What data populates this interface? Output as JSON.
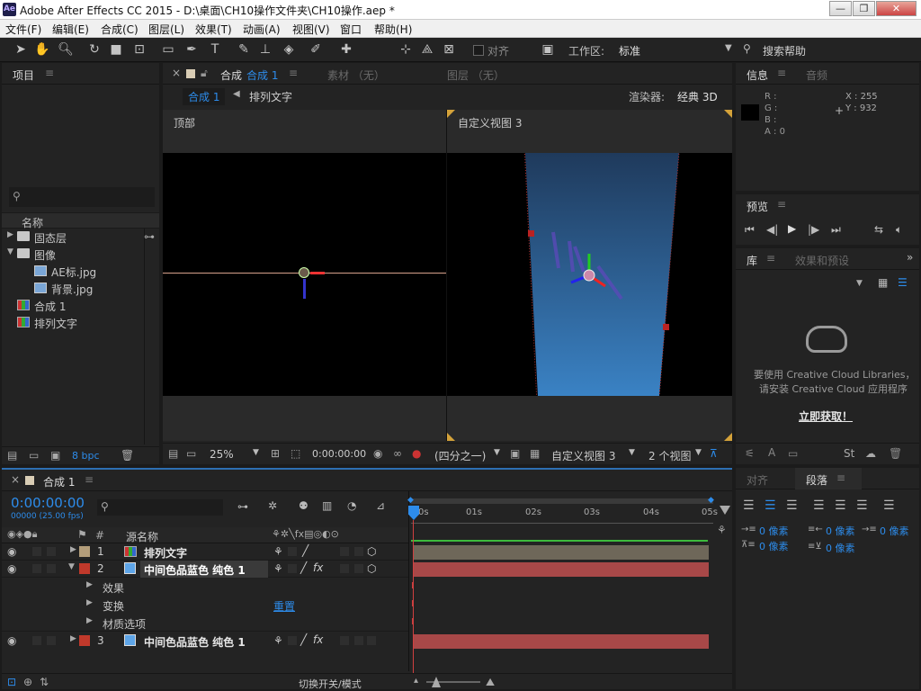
{
  "window": {
    "title": "Adobe After Effects CC 2015 - D:\\桌面\\CH10操作文件夹\\CH10操作.aep *",
    "app_icon": "Ae",
    "min": "—",
    "max": "❐",
    "close": "✕"
  },
  "menu": [
    "文件(F)",
    "编辑(E)",
    "合成(C)",
    "图层(L)",
    "效果(T)",
    "动画(A)",
    "视图(V)",
    "窗口",
    "帮助(H)"
  ],
  "toolbar": {
    "snap_label": "对齐",
    "workspace_label": "工作区:",
    "workspace_value": "标准",
    "search_help": "搜索帮助"
  },
  "project": {
    "title": "项目",
    "col_name": "名称",
    "footer_bpc": "8 bpc",
    "items": [
      {
        "name": "固态层",
        "type": "folder"
      },
      {
        "name": "图像",
        "type": "folder"
      },
      {
        "name": "AE标.jpg",
        "type": "image"
      },
      {
        "name": "背景.jpg",
        "type": "image"
      },
      {
        "name": "合成 1",
        "type": "comp"
      },
      {
        "name": "排列文字",
        "type": "comp"
      }
    ]
  },
  "comp_viewer": {
    "tab_label": "合成",
    "tab_name": "合成 1",
    "footage_tab": "素材 （无）",
    "layer_tab": "图层 （无）",
    "breadcrumb_active": "合成 1",
    "breadcrumb_next": "排列文字",
    "renderer_label": "渲染器:",
    "renderer_value": "经典 3D",
    "view_left": "顶部",
    "view_right": "自定义视图 3",
    "bottom": {
      "zoom": "25%",
      "timecode": "0:00:00:00",
      "resolution": "(四分之一)",
      "view_name": "自定义视图 3",
      "view_count": "2 个视图"
    }
  },
  "info": {
    "tab_info": "信息",
    "tab_audio": "音频",
    "r": "R :",
    "g": "G :",
    "b": "B :",
    "a": "A : 0",
    "x": "X : 255",
    "y": "Y : 932"
  },
  "preview": {
    "title": "预览"
  },
  "library": {
    "tab_lib": "库",
    "tab_effects": "效果和预设",
    "message_line1": "要使用 Creative Cloud Libraries，",
    "message_line2": "请安装 Creative Cloud 应用程序",
    "link": "立即获取！"
  },
  "paragraph": {
    "tab_align": "对齐",
    "tab_para": "段落",
    "indent_left": "0 像素",
    "indent_right": "0 像素",
    "indent_first": "0 像素",
    "space_before": "0 像素",
    "space_after": "0 像素"
  },
  "timeline": {
    "tab_name": "合成 1",
    "timecode": "0:00:00:00",
    "fps": "00000 (25.00 fps)",
    "col_num": "#",
    "col_source": "源名称",
    "time_marks": [
      "0s",
      "01s",
      "02s",
      "03s",
      "04s",
      "05s"
    ],
    "footer_label": "切换开关/模式",
    "layers": [
      {
        "num": "1",
        "name": "排列文字",
        "label_color": "#b39d7a",
        "icon": "comp"
      },
      {
        "num": "2",
        "name": "中间色品蓝色 纯色 1",
        "label_color": "#c0392b",
        "icon": "solid"
      },
      {
        "num": "3",
        "name": "中间色品蓝色 纯色 1",
        "label_color": "#c0392b",
        "icon": "solid"
      }
    ],
    "props": [
      "效果",
      "变换",
      "材质选项"
    ],
    "reset_label": "重置"
  }
}
